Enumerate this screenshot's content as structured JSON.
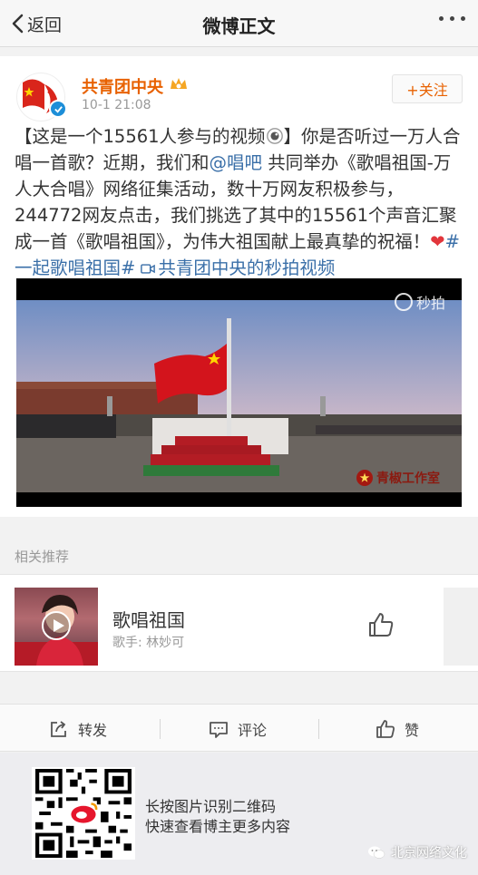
{
  "navbar": {
    "back_label": "返回",
    "title": "微博正文"
  },
  "post": {
    "author": "共青团中央",
    "time": "10-1 21:08",
    "follow_label": "+关注",
    "text_parts": {
      "p1": "【这是一个15561人参与的视频",
      "p2": "】你是否听过一万人合唱一首歌？近期，我们和",
      "mention": "@唱吧",
      "p3": " 共同举办《歌唱祖国-万人大合唱》网络征集活动，数十万网友积极参与，244772网友点击，我们挑选了其中的15561个声音汇聚成一首《歌唱祖国》，为伟大祖国献上最真挚的祝福！",
      "hashtag": "#一起歌唱祖国#",
      "video_link": "共青团中央的秒拍视频"
    },
    "video": {
      "watermark": "秒拍",
      "studio": "青椒工作室"
    }
  },
  "related": {
    "label": "相关推荐",
    "song_title": "歌唱祖国",
    "song_artist": "歌手: 林妙可"
  },
  "actions": {
    "repost": "转发",
    "comment": "评论",
    "like": "赞"
  },
  "footer": {
    "line1": "长按图片识别二维码",
    "line2": "快速查看博主更多内容",
    "source": "北京网络文化"
  },
  "colors": {
    "author": "#e86100",
    "link": "#3a6fa8",
    "heart": "#e2363c",
    "verified": "#1c8ed8"
  }
}
